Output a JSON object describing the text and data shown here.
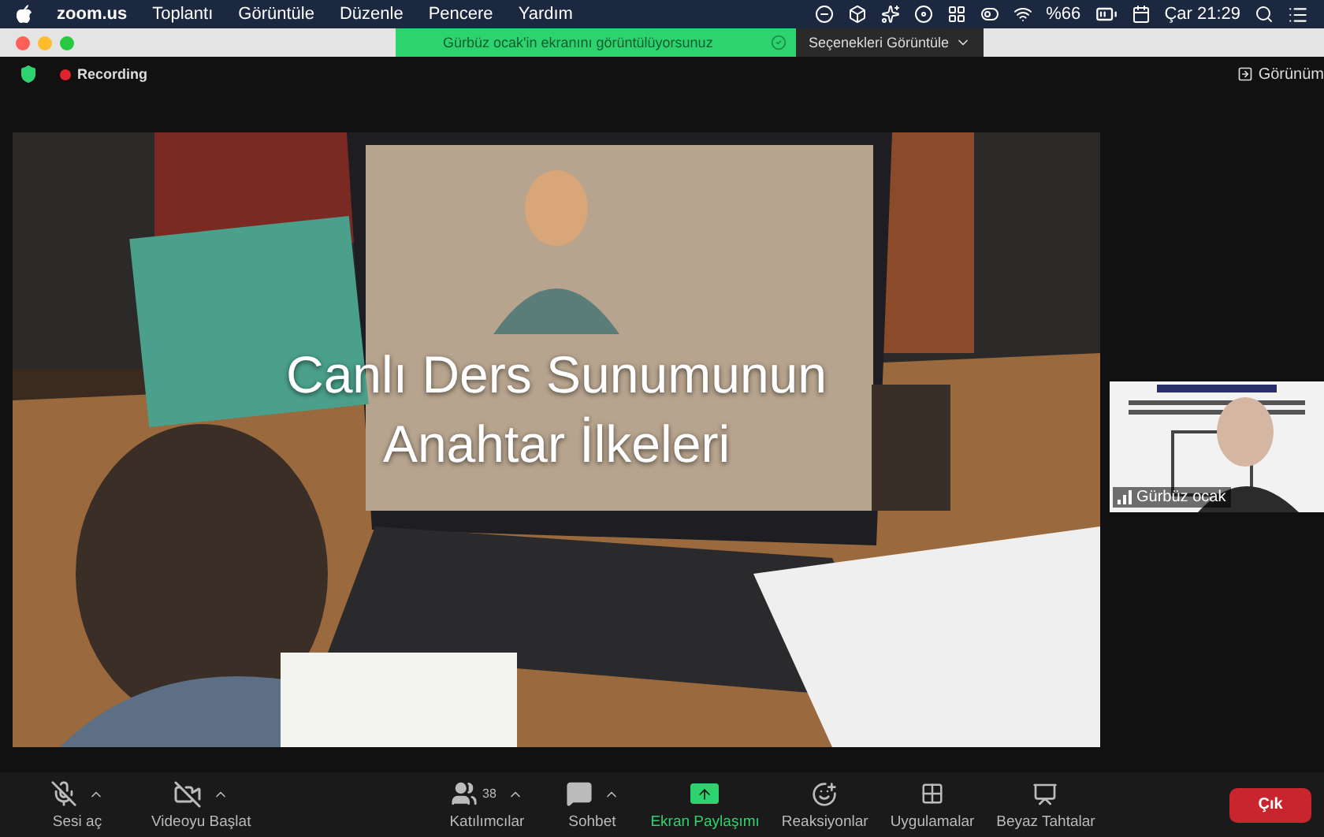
{
  "menu_bar": {
    "app": "zoom.us",
    "menus": [
      "Toplantı",
      "Görüntüle",
      "Düzenle",
      "Pencere",
      "Yardım"
    ],
    "battery": "%66",
    "clock": "Çar 21:29"
  },
  "share_banner": {
    "text": "Gürbüz ocak'in ekranını görüntülüyorsunuz",
    "options": "Seçenekleri Görüntüle"
  },
  "meeting": {
    "recording": "Recording",
    "view": "Görünüm"
  },
  "slide": {
    "title_lines": [
      "Canlı Ders Sunumunun",
      "Anahtar İlkeleri"
    ]
  },
  "participant": {
    "name": "Gürbüz ocak"
  },
  "toolbar": {
    "items": [
      {
        "kind": "audio",
        "label": "Sesi aç",
        "off": true,
        "caret": true,
        "active": false
      },
      {
        "kind": "video",
        "label": "Videoyu Başlat",
        "off": true,
        "caret": true,
        "active": false
      },
      {
        "kind": "participants",
        "label": "Katılımcılar",
        "count": "38",
        "caret": true,
        "active": false
      },
      {
        "kind": "chat",
        "label": "Sohbet",
        "caret": true,
        "active": false
      },
      {
        "kind": "share",
        "label": "Ekran Paylaşımı",
        "caret": false,
        "active": true
      },
      {
        "kind": "reactions",
        "label": "Reaksiyonlar",
        "caret": false,
        "active": false
      },
      {
        "kind": "apps",
        "label": "Uygulamalar",
        "caret": false,
        "active": false
      },
      {
        "kind": "whiteboard",
        "label": "Beyaz Tahtalar",
        "caret": false,
        "active": false
      }
    ],
    "leave": "Çık"
  }
}
